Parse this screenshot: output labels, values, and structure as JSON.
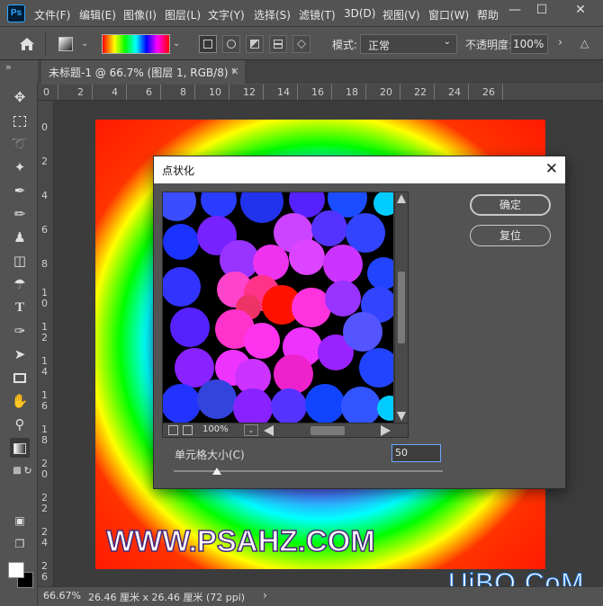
{
  "app": {
    "logo": "Ps"
  },
  "menu": [
    "文件(F)",
    "编辑(E)",
    "图像(I)",
    "图层(L)",
    "文字(Y)",
    "选择(S)",
    "滤镜(T)",
    "3D(D)",
    "视图(V)",
    "窗口(W)",
    "帮助"
  ],
  "window_controls": [
    "—",
    "☐",
    "✕"
  ],
  "options": {
    "mode_label": "模式:",
    "mode_value": "正常",
    "opacity_label": "不透明度:",
    "opacity_value": "100%"
  },
  "document_tab": {
    "title": "未标题-1 @ 66.7% (图层 1, RGB/8) *",
    "close": "×"
  },
  "ruler_h": [
    "0",
    "2",
    "4",
    "6",
    "8",
    "10",
    "12",
    "14",
    "16",
    "18",
    "20",
    "22",
    "24",
    "26"
  ],
  "ruler_v": [
    "0",
    "2",
    "4",
    "6",
    "8",
    "1\n0",
    "1\n2",
    "1\n4",
    "1\n6",
    "1\n8",
    "2\n0",
    "2\n2",
    "2\n4",
    "2\n6"
  ],
  "canvas": {
    "watermark": "WWW.PSAHZ.COM",
    "corner_logo": "UiBQ.CoM"
  },
  "status": {
    "zoom": "66.67%",
    "doc_info": "26.46 厘米 x 26.46 厘米 (72 ppi)",
    "arrow": "›"
  },
  "dialog": {
    "title": "点状化",
    "close": "✕",
    "ok_label": "确定",
    "reset_label": "复位",
    "preview_zoom": "100%",
    "param_label": "单元格大小(C)",
    "cell_size": "50",
    "cell_size_fraction": 0.16
  },
  "icons": [
    "home-icon",
    "move-icon",
    "marquee-icon",
    "lasso-icon",
    "magic-wand-icon",
    "eyedropper-icon",
    "brush-icon",
    "stamp-icon",
    "eraser-icon",
    "gradient-icon",
    "pen-icon",
    "type-icon",
    "selection-icon",
    "rectangle-icon",
    "hand-icon",
    "zoom-icon"
  ],
  "colors": {
    "foreground": "#ffffff",
    "background": "#000000"
  }
}
